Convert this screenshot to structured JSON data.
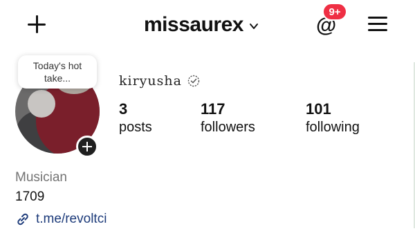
{
  "header": {
    "username": "missaurex",
    "notification_badge": "9+",
    "icons": {
      "create": "plus-icon",
      "username_menu": "chevron-down-icon",
      "threads": "threads-icon",
      "menu": "hamburger-menu-icon"
    }
  },
  "profile": {
    "note": "Today's hot take...",
    "display_name": "kiryusha",
    "stats": {
      "posts": {
        "value": "3",
        "label": "posts"
      },
      "followers": {
        "value": "117",
        "label": "followers"
      },
      "following": {
        "value": "101",
        "label": "following"
      }
    },
    "category": "Musician",
    "bio": "1709",
    "link": "t.me/revoltci"
  },
  "colors": {
    "badge": "#ef2f44",
    "link": "#1d3b7a",
    "category": "#737373"
  }
}
